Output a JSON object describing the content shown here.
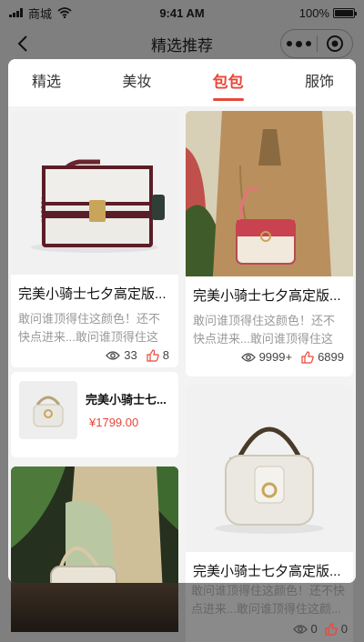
{
  "status_bar": {
    "carrier": "商城",
    "time": "9:41 AM",
    "battery": "100%"
  },
  "nav": {
    "title": "精选推荐"
  },
  "tabs": [
    {
      "label": "精选",
      "active": false
    },
    {
      "label": "美妆",
      "active": false
    },
    {
      "label": "包包",
      "active": true
    },
    {
      "label": "服饰",
      "active": false
    }
  ],
  "cards": [
    {
      "title": "完美小骑士七夕高定版...",
      "desc": "敢问谁顶得住这颜色！还不快点进来...敢问谁顶得住这颜...",
      "views": "33",
      "likes": "8"
    },
    {
      "title": "完美小骑士七夕高定版...",
      "desc": "敢问谁顶得住这颜色！还不快点进来...敢问谁顶得住这颜...",
      "views": "9999+",
      "likes": "6899"
    },
    {
      "title": "完美小骑士七夕高定版..."
    }
  ],
  "product": {
    "title": "完美小骑士七...",
    "price": "¥1799.00"
  },
  "background_card": {
    "desc": "敢问谁顶得住这颜色！还不快点进来...敢问谁顶得住这颜...",
    "views": "0",
    "likes": "0"
  },
  "colors": {
    "accent": "#e8473a",
    "overlay": "#7f7f7f"
  },
  "icons": [
    "signal-icon",
    "wifi-icon",
    "battery-icon",
    "back-icon",
    "more-icon",
    "target-icon",
    "eye-icon",
    "thumb-up-icon"
  ]
}
